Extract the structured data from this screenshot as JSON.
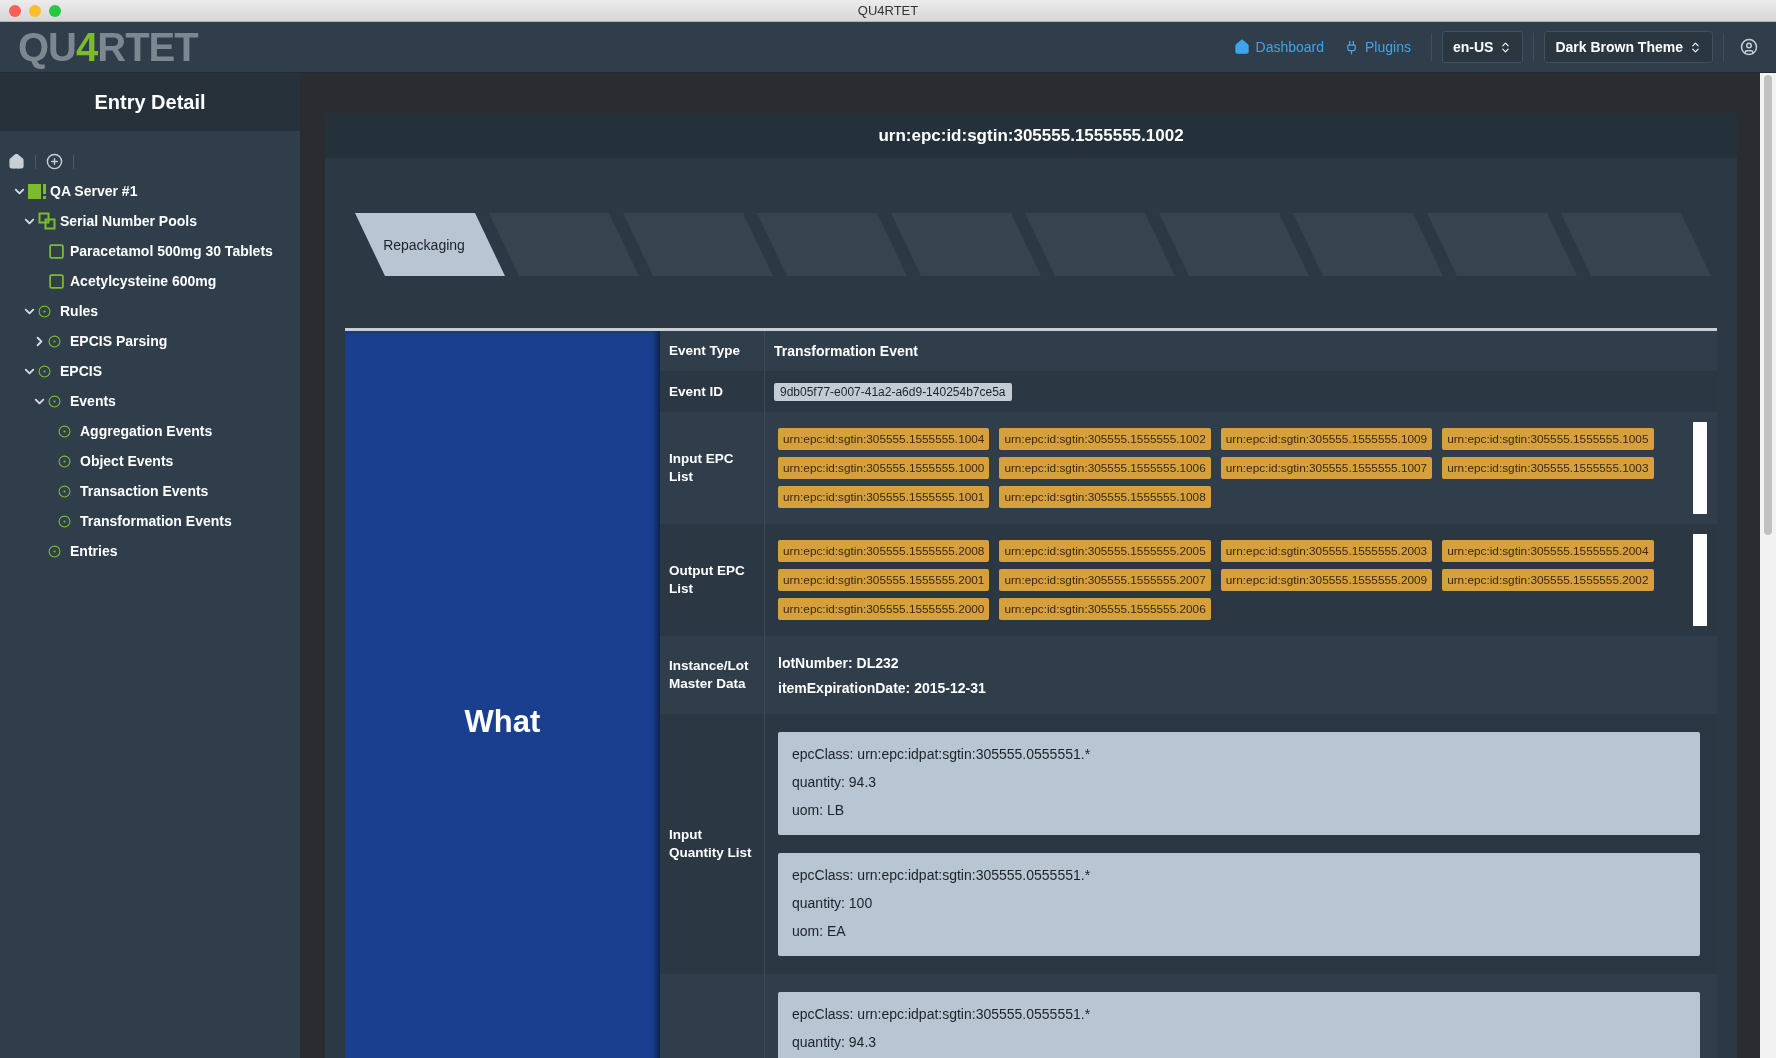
{
  "window": {
    "title": "QU4RTET"
  },
  "logo": {
    "parts": [
      {
        "text": "QU",
        "accent": false
      },
      {
        "text": "4",
        "accent": true
      },
      {
        "text": "RTET",
        "accent": false
      }
    ]
  },
  "nav": {
    "links": [
      {
        "label": "Dashboard",
        "kind": "home"
      },
      {
        "label": "Plugins",
        "kind": "plug"
      }
    ],
    "selects": [
      {
        "value": "en-US"
      },
      {
        "value": "Dark Brown Theme"
      }
    ]
  },
  "sidebar": {
    "title": "Entry Detail",
    "tree": [
      {
        "label": "QA Server #1",
        "kind": "server",
        "expanded": true,
        "children": [
          {
            "label": "Serial Number Pools",
            "kind": "pools",
            "expanded": true,
            "children": [
              {
                "label": "Paracetamol 500mg 30 Tablets",
                "kind": "pool"
              },
              {
                "label": "Acetylcysteine 600mg",
                "kind": "pool"
              }
            ]
          },
          {
            "label": "Rules",
            "kind": "node",
            "expanded": true,
            "children": [
              {
                "label": "EPCIS Parsing",
                "kind": "node",
                "expanded": false
              }
            ]
          },
          {
            "label": "EPCIS",
            "kind": "node",
            "expanded": true,
            "children": [
              {
                "label": "Events",
                "kind": "node",
                "expanded": true,
                "children": [
                  {
                    "label": "Aggregation Events",
                    "kind": "node"
                  },
                  {
                    "label": "Object Events",
                    "kind": "node"
                  },
                  {
                    "label": "Transaction Events",
                    "kind": "node"
                  },
                  {
                    "label": "Transformation Events",
                    "kind": "node"
                  }
                ]
              },
              {
                "label": "Entries",
                "kind": "node"
              }
            ]
          }
        ]
      }
    ]
  },
  "card": {
    "title": "urn:epc:id:sgtin:305555.1555555.1002",
    "steps": [
      {
        "label": "Repackaging",
        "selected": true
      },
      {
        "selected": false
      },
      {
        "selected": false
      },
      {
        "selected": false
      },
      {
        "selected": false
      },
      {
        "selected": false
      },
      {
        "selected": false
      },
      {
        "selected": false
      },
      {
        "selected": false
      },
      {
        "selected": false
      }
    ],
    "section": "What",
    "rows": [
      {
        "label": "Event Type",
        "kind": "text",
        "value": "Transformation Event"
      },
      {
        "label": "Event ID",
        "kind": "code",
        "value": "9db05f77-e007-41a2-a6d9-140254b7ce5a"
      },
      {
        "label": "Input EPC List",
        "kind": "tags",
        "items": [
          "urn:epc:id:sgtin:305555.1555555.1004",
          "urn:epc:id:sgtin:305555.1555555.1002",
          "urn:epc:id:sgtin:305555.1555555.1009",
          "urn:epc:id:sgtin:305555.1555555.1005",
          "urn:epc:id:sgtin:305555.1555555.1000",
          "urn:epc:id:sgtin:305555.1555555.1006",
          "urn:epc:id:sgtin:305555.1555555.1007",
          "urn:epc:id:sgtin:305555.1555555.1003",
          "urn:epc:id:sgtin:305555.1555555.1001",
          "urn:epc:id:sgtin:305555.1555555.1008"
        ]
      },
      {
        "label": "Output EPC List",
        "kind": "tags",
        "items": [
          "urn:epc:id:sgtin:305555.1555555.2008",
          "urn:epc:id:sgtin:305555.1555555.2005",
          "urn:epc:id:sgtin:305555.1555555.2003",
          "urn:epc:id:sgtin:305555.1555555.2004",
          "urn:epc:id:sgtin:305555.1555555.2001",
          "urn:epc:id:sgtin:305555.1555555.2007",
          "urn:epc:id:sgtin:305555.1555555.2009",
          "urn:epc:id:sgtin:305555.1555555.2002",
          "urn:epc:id:sgtin:305555.1555555.2000",
          "urn:epc:id:sgtin:305555.1555555.2006"
        ]
      },
      {
        "label": "Instance/Lot Master Data",
        "kind": "lines",
        "lines": [
          "lotNumber: DL232",
          "itemExpirationDate: 2015-12-31"
        ]
      },
      {
        "label": "Input Quantity List",
        "kind": "cards",
        "cards": [
          [
            "epcClass: urn:epc:idpat:sgtin:305555.0555551.*",
            "quantity: 94.3",
            "uom: LB"
          ],
          [
            "epcClass: urn:epc:idpat:sgtin:305555.0555551.*",
            "quantity: 100",
            "uom: EA"
          ]
        ]
      },
      {
        "kind": "cards",
        "cards": [
          [
            "epcClass: urn:epc:idpat:sgtin:305555.0555551.*",
            "quantity: 94.3"
          ]
        ]
      }
    ]
  }
}
